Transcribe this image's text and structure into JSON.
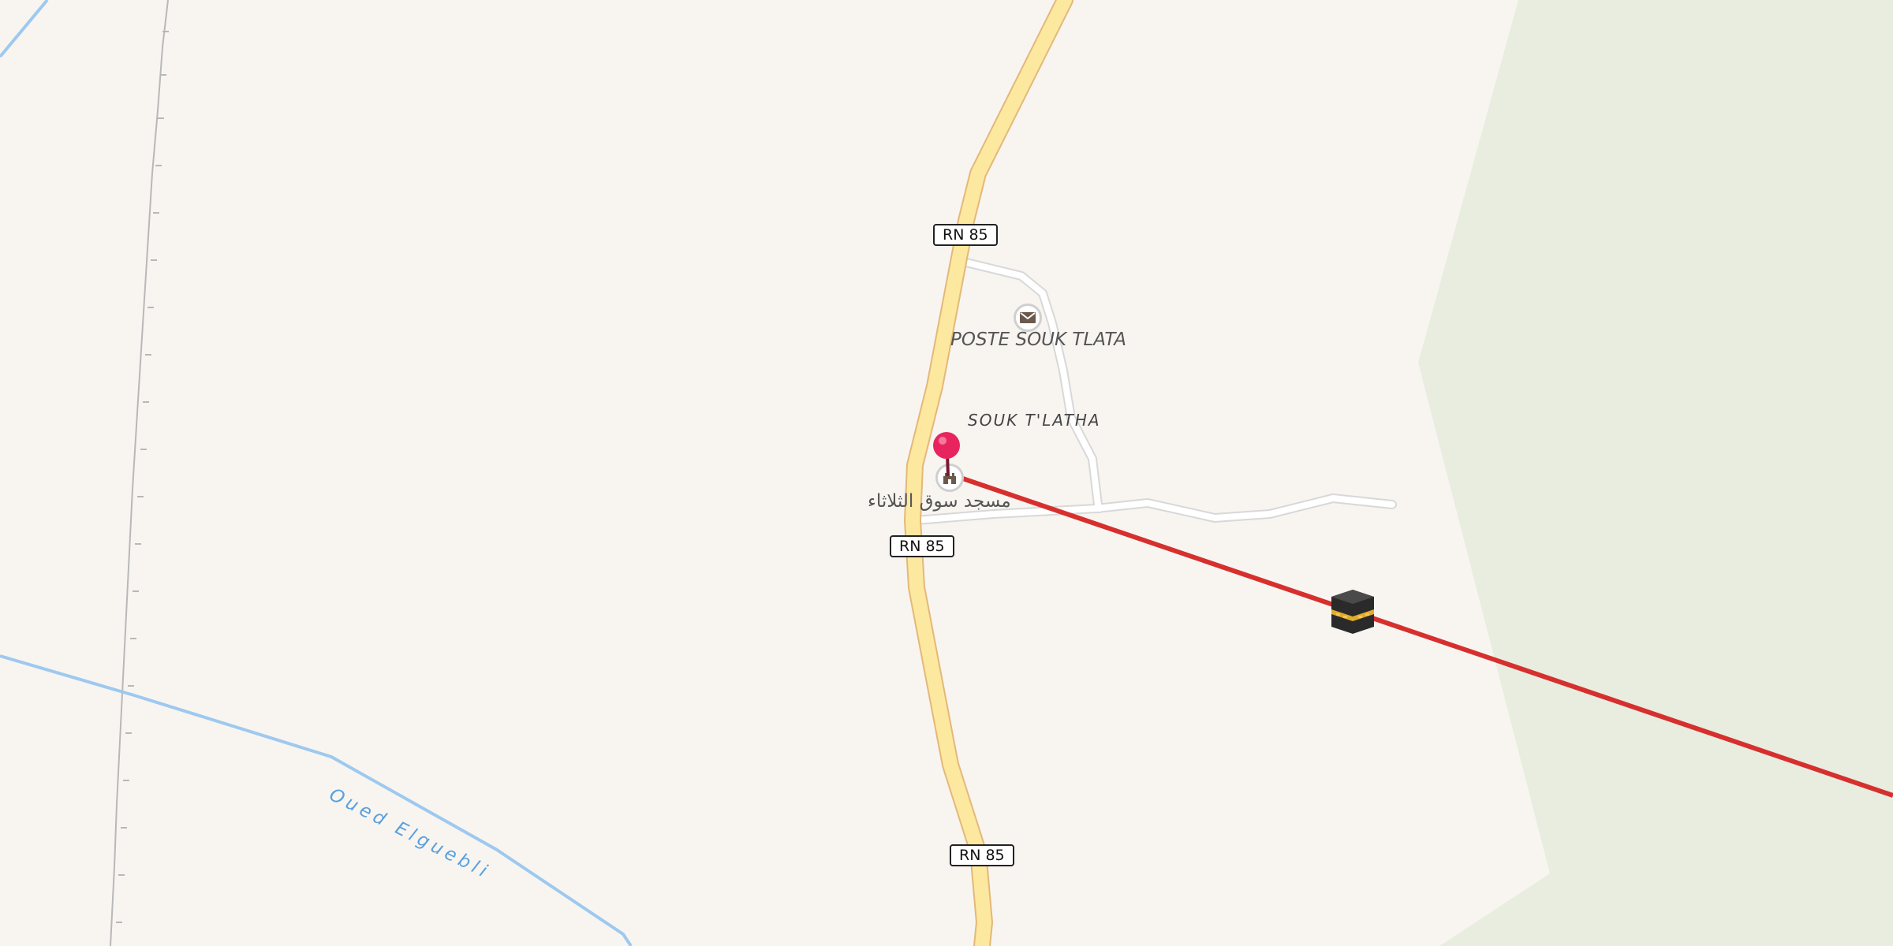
{
  "map": {
    "road_shields": [
      {
        "ref": "RN 85"
      },
      {
        "ref": "RN 85"
      },
      {
        "ref": "RN 85"
      }
    ],
    "places": {
      "post_office": "POSTE SOUK TLATA",
      "locality": "SOUK T'LATHA",
      "mosque": "مسجد سوق الثلاثاء"
    },
    "waterway": "Oued Elguebli",
    "icons": {
      "post": "envelope-icon",
      "mosque": "mosque-icon",
      "marker": "location-pin-icon",
      "kaaba": "kaaba-icon"
    },
    "colors": {
      "background": "#f8f5f1",
      "green_area": "#e8ede0",
      "primary_road_fill": "#fde8a0",
      "primary_road_casing": "#e4b878",
      "minor_road": "#ffffff",
      "minor_road_casing": "#d8d8d8",
      "water": "#9ec9ef",
      "water_label": "#5aa0dd",
      "rail": "#b8b8b8",
      "qibla_line": "#d6302e",
      "marker": "#e8245f"
    }
  }
}
